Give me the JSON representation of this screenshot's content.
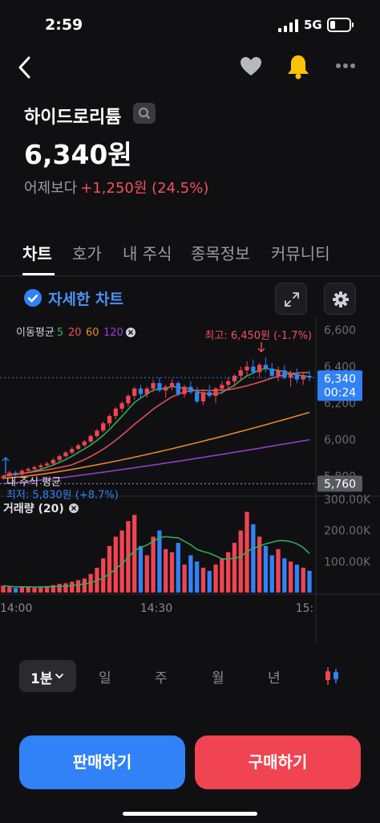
{
  "status": {
    "time": "2:59",
    "network": "5G"
  },
  "stock": {
    "name": "하이드로리튬",
    "price": "6,340원",
    "change_label": "어제보다",
    "change_value": "+1,250원 (24.5%)"
  },
  "tabs": [
    {
      "label": "차트",
      "active": true
    },
    {
      "label": "호가"
    },
    {
      "label": "내 주식"
    },
    {
      "label": "종목정보"
    },
    {
      "label": "커뮤니티"
    }
  ],
  "detail_chart_label": "자세한 차트",
  "chart_data": {
    "type": "candlestick",
    "indicator": {
      "label": "이동평균",
      "periods": [
        "5",
        "20",
        "60",
        "120"
      ],
      "colors": [
        "#2fb35b",
        "#f0515b",
        "#f28c28",
        "#9b3fd0"
      ]
    },
    "high_annotation": "최고: 6,450원 (-1.7%)",
    "current_price_label": "6,340",
    "countdown_label": "00:24",
    "avg_price_tag": "5,760",
    "avg_line_label": "내 주식 평균",
    "low_annotation": "최저: 5,830원 (+8.7%)",
    "price_ticks": [
      "6,600",
      "6,400",
      "6,200",
      "6,000",
      "5,800"
    ],
    "y_range": [
      5700,
      6640
    ],
    "volume_label": "거래량 (20)",
    "volume_ticks": [
      "300.00K",
      "200.00K",
      "100.00K"
    ],
    "volume_range": [
      0,
      300000
    ],
    "time_ticks": [
      "14:00",
      "14:30",
      "15:"
    ],
    "candles": [
      [
        5790,
        5810,
        5780,
        5800
      ],
      [
        5800,
        5830,
        5790,
        5820
      ],
      [
        5820,
        5830,
        5800,
        5810
      ],
      [
        5810,
        5840,
        5800,
        5830
      ],
      [
        5830,
        5850,
        5820,
        5840
      ],
      [
        5840,
        5860,
        5830,
        5850
      ],
      [
        5850,
        5870,
        5840,
        5860
      ],
      [
        5860,
        5880,
        5850,
        5870
      ],
      [
        5870,
        5900,
        5860,
        5890
      ],
      [
        5890,
        5920,
        5880,
        5910
      ],
      [
        5910,
        5940,
        5900,
        5930
      ],
      [
        5930,
        5960,
        5920,
        5950
      ],
      [
        5950,
        5980,
        5940,
        5970
      ],
      [
        5970,
        6000,
        5960,
        5990
      ],
      [
        5990,
        6030,
        5980,
        6020
      ],
      [
        6020,
        6060,
        6010,
        6050
      ],
      [
        6050,
        6100,
        6040,
        6090
      ],
      [
        6090,
        6140,
        6070,
        6130
      ],
      [
        6130,
        6180,
        6110,
        6170
      ],
      [
        6170,
        6210,
        6150,
        6200
      ],
      [
        6200,
        6250,
        6180,
        6240
      ],
      [
        6240,
        6290,
        6220,
        6280
      ],
      [
        6280,
        6300,
        6230,
        6250
      ],
      [
        6250,
        6290,
        6230,
        6280
      ],
      [
        6280,
        6330,
        6260,
        6310
      ],
      [
        6310,
        6340,
        6260,
        6270
      ],
      [
        6270,
        6300,
        6230,
        6290
      ],
      [
        6290,
        6330,
        6270,
        6310
      ],
      [
        6310,
        6320,
        6240,
        6250
      ],
      [
        6250,
        6300,
        6230,
        6290
      ],
      [
        6290,
        6320,
        6250,
        6260
      ],
      [
        6260,
        6290,
        6200,
        6210
      ],
      [
        6210,
        6270,
        6190,
        6260
      ],
      [
        6260,
        6300,
        6230,
        6240
      ],
      [
        6240,
        6290,
        6200,
        6280
      ],
      [
        6280,
        6320,
        6250,
        6300
      ],
      [
        6300,
        6340,
        6270,
        6320
      ],
      [
        6320,
        6360,
        6290,
        6350
      ],
      [
        6350,
        6400,
        6320,
        6380
      ],
      [
        6380,
        6430,
        6350,
        6400
      ],
      [
        6400,
        6440,
        6360,
        6370
      ],
      [
        6370,
        6420,
        6340,
        6410
      ],
      [
        6410,
        6450,
        6370,
        6390
      ],
      [
        6390,
        6420,
        6340,
        6350
      ],
      [
        6350,
        6400,
        6320,
        6380
      ],
      [
        6380,
        6410,
        6330,
        6340
      ],
      [
        6340,
        6380,
        6290,
        6360
      ],
      [
        6360,
        6390,
        6310,
        6330
      ],
      [
        6330,
        6370,
        6300,
        6350
      ],
      [
        6350,
        6380,
        6320,
        6340
      ]
    ],
    "volumes": [
      22000,
      18000,
      15000,
      20000,
      17000,
      16000,
      19000,
      21000,
      24000,
      28000,
      30000,
      35000,
      40000,
      45000,
      60000,
      80000,
      110000,
      150000,
      180000,
      200000,
      230000,
      250000,
      150000,
      120000,
      180000,
      200000,
      140000,
      130000,
      160000,
      90000,
      120000,
      100000,
      80000,
      70000,
      90000,
      110000,
      130000,
      160000,
      200000,
      260000,
      220000,
      180000,
      150000,
      120000,
      140000,
      110000,
      100000,
      90000,
      80000,
      70000
    ]
  },
  "periods": [
    {
      "label": "1분",
      "selected": true
    },
    {
      "label": "일"
    },
    {
      "label": "주"
    },
    {
      "label": "월"
    },
    {
      "label": "년"
    }
  ],
  "actions": {
    "sell": "판매하기",
    "buy": "구매하기"
  }
}
